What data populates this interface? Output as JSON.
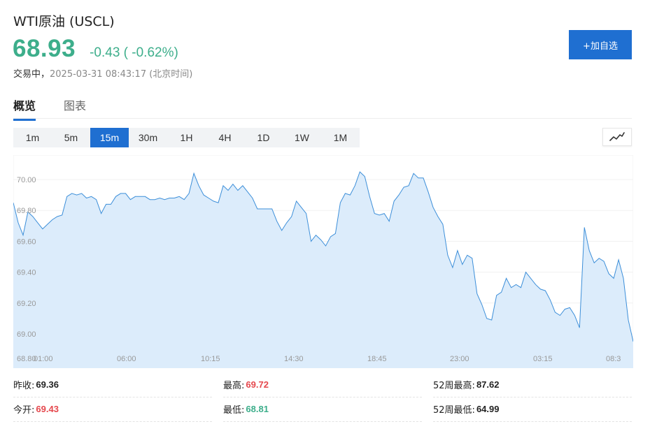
{
  "header": {
    "title": "WTI原油  (USCL)",
    "price": "68.93",
    "change": "-0.43 ( -0.62%)",
    "status_label": "交易中，",
    "timestamp": "2025-03-31 08:43:17 (北京时间)",
    "add_button": "+加自选",
    "price_color": "#3dae8b"
  },
  "tabs": [
    {
      "label": "概览",
      "active": true
    },
    {
      "label": "图表",
      "active": false
    }
  ],
  "intervals": [
    "1m",
    "5m",
    "15m",
    "30m",
    "1H",
    "4H",
    "1D",
    "1W",
    "1M"
  ],
  "selected_interval": "15m",
  "chart_type_icon": "line-chart-icon",
  "chart_data": {
    "type": "area",
    "y_ticks": [
      "70.00",
      "69.80",
      "69.60",
      "69.40",
      "69.20",
      "69.00",
      "68.80"
    ],
    "x_ticks": [
      "01:00",
      "06:00",
      "10:15",
      "14:30",
      "18:45",
      "23:00",
      "03:15",
      "08:3"
    ],
    "ylim": [
      68.8,
      70.12
    ],
    "line_color": "#3d8fd9",
    "fill_color": "#dcecfb",
    "values": [
      69.85,
      69.72,
      69.64,
      69.79,
      69.76,
      69.72,
      69.68,
      69.71,
      69.74,
      69.76,
      69.77,
      69.89,
      69.91,
      69.9,
      69.91,
      69.88,
      69.89,
      69.87,
      69.78,
      69.84,
      69.84,
      69.89,
      69.91,
      69.91,
      69.87,
      69.89,
      69.89,
      69.89,
      69.87,
      69.87,
      69.88,
      69.87,
      69.88,
      69.88,
      69.89,
      69.87,
      69.91,
      70.04,
      69.96,
      69.9,
      69.88,
      69.86,
      69.85,
      69.96,
      69.93,
      69.97,
      69.93,
      69.96,
      69.92,
      69.88,
      69.81,
      69.81,
      69.81,
      69.81,
      69.73,
      69.67,
      69.72,
      69.76,
      69.86,
      69.82,
      69.78,
      69.6,
      69.64,
      69.61,
      69.57,
      69.63,
      69.65,
      69.85,
      69.91,
      69.9,
      69.96,
      70.05,
      70.02,
      69.89,
      69.78,
      69.77,
      69.78,
      69.73,
      69.86,
      69.9,
      69.95,
      69.96,
      70.04,
      70.01,
      70.01,
      69.92,
      69.82,
      69.76,
      69.71,
      69.51,
      69.43,
      69.54,
      69.45,
      69.51,
      69.49,
      69.26,
      69.19,
      69.1,
      69.09,
      69.25,
      69.27,
      69.36,
      69.3,
      69.32,
      69.3,
      69.4,
      69.36,
      69.32,
      69.29,
      69.28,
      69.22,
      69.14,
      69.12,
      69.16,
      69.17,
      69.12,
      69.04,
      69.69,
      69.54,
      69.46,
      69.49,
      69.47,
      69.39,
      69.36,
      69.48,
      69.36,
      69.09,
      68.95
    ]
  },
  "stats": [
    {
      "label": "昨收:",
      "value": "69.36",
      "color": "dark"
    },
    {
      "label": "最高:",
      "value": "69.72",
      "color": "red"
    },
    {
      "label": "52周最高:",
      "value": "87.62",
      "color": "dark"
    },
    {
      "label": "今开:",
      "value": "69.43",
      "color": "red"
    },
    {
      "label": "最低:",
      "value": "68.81",
      "color": "green"
    },
    {
      "label": "52周最低:",
      "value": "64.99",
      "color": "dark"
    }
  ]
}
